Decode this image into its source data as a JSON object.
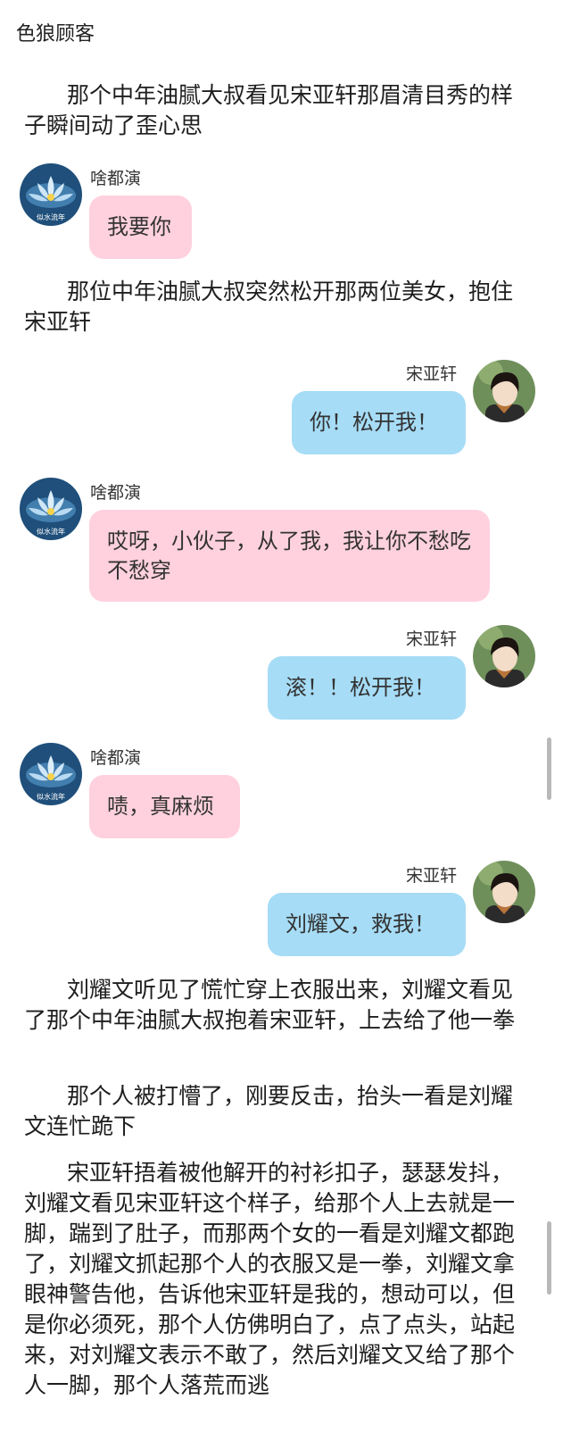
{
  "header": {
    "title": "色狼顾客"
  },
  "story": [
    {
      "text": "那个中年油腻大叔看见宋亚轩那眉清目秀的样子瞬间动了歪心思"
    },
    {
      "text": "那位中年油腻大叔突然松开那两位美女，抱住宋亚轩"
    },
    {
      "text": "刘耀文听见了慌忙穿上衣服出来，刘耀文看见了那个中年油腻大叔抱着宋亚轩，上去给了他一拳"
    },
    {
      "text": "那个人被打懵了，刚要反击，抬头一看是刘耀文连忙跪下"
    },
    {
      "text": "宋亚轩捂着被他解开的衬衫扣子，瑟瑟发抖，刘耀文看见宋亚轩这个样子，给那个人上去就是一脚，踹到了肚子，而那两个女的一看是刘耀文都跑了，刘耀文抓起那个人的衣服又是一拳，刘耀文拿眼神警告他，告诉他宋亚轩是我的，想动可以，但是你必须死，那个人仿佛明白了，点了点头，站起来，对刘耀文表示不敢了，然后刘耀文又给了那个人一脚，那个人落荒而逃"
    }
  ],
  "messages": [
    {
      "side": "left",
      "name": "啥都演",
      "avatar_caption": "似水流年",
      "text": "我要你"
    },
    {
      "side": "right",
      "name": "宋亚轩",
      "text": "你！松开我！"
    },
    {
      "side": "left",
      "name": "啥都演",
      "avatar_caption": "似水流年",
      "text": "哎呀，小伙子，从了我，我让你不愁吃不愁穿"
    },
    {
      "side": "right",
      "name": "宋亚轩",
      "text": "滚！！松开我！"
    },
    {
      "side": "left",
      "name": "啥都演",
      "avatar_caption": "似水流年",
      "text": "啧，真麻烦"
    },
    {
      "side": "right",
      "name": "宋亚轩",
      "text": "刘耀文，救我！"
    }
  ],
  "icons": {
    "left_avatar": "lotus-avatar-icon",
    "right_avatar": "person-avatar-icon"
  },
  "colors": {
    "left_bubble": "#ffd1de",
    "right_bubble": "#a6dcf6",
    "text": "#1e1e1e"
  }
}
